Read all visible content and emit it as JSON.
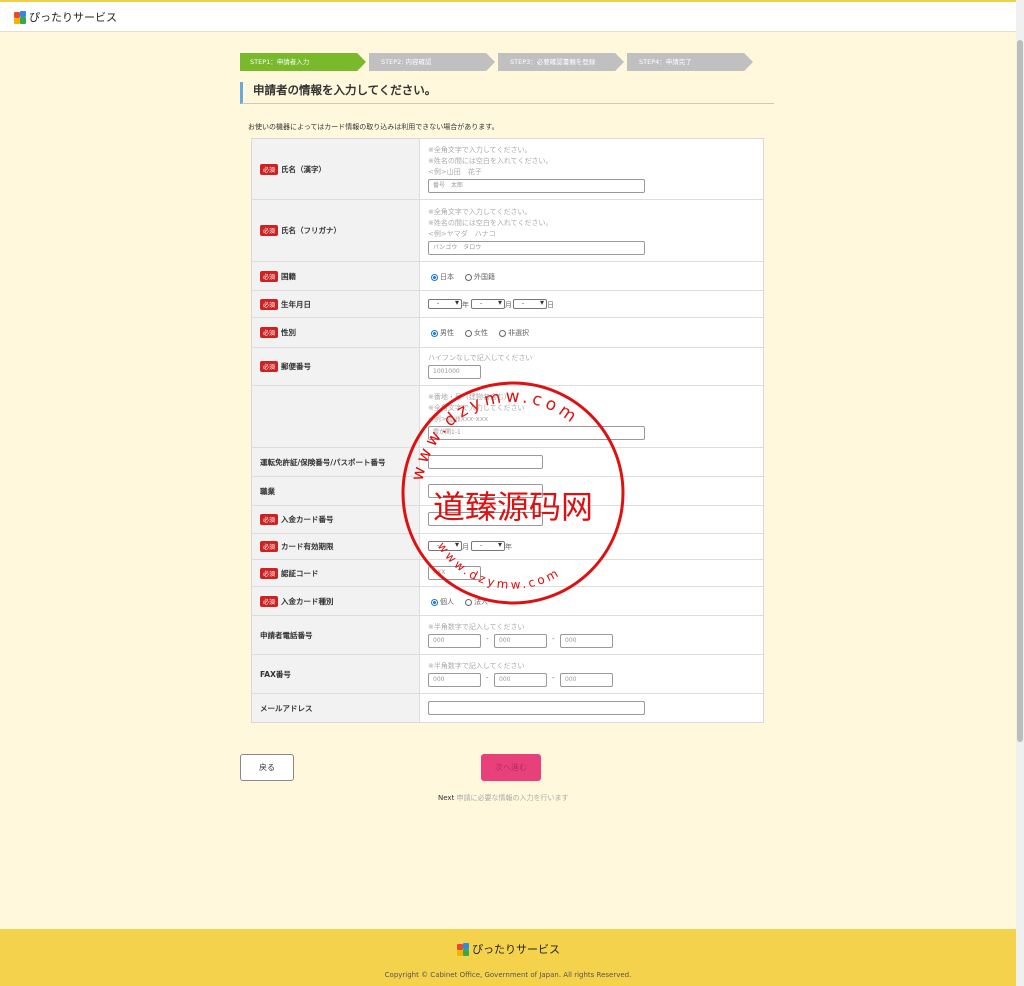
{
  "header": {
    "app_name": "ぴったりサービス"
  },
  "steps": [
    {
      "label": "STEP1：申請者入力",
      "active": true
    },
    {
      "label": "STEP2: 内容確認",
      "active": false
    },
    {
      "label": "STEP3：必要確認書類を登録",
      "active": false
    },
    {
      "label": "STEP4：申請完了",
      "active": false
    }
  ],
  "page_title": "申請者の情報を入力してください。",
  "notice": "お使いの機器によってはカード情報の取り込みは利用できない場合があります。",
  "required_badge": "必須",
  "form": {
    "name_kanji": {
      "label": "氏名（漢字）",
      "hints": [
        "※全角文字で入力してください。",
        "※姓名の間には空白を入れてください。",
        "<例>山田　花子"
      ],
      "placeholder": "番号　太郎"
    },
    "name_kana": {
      "label": "氏名（フリガナ）",
      "hints": [
        "※全角文字で入力してください。",
        "※姓名の間には空白を入れてください。",
        "<例>ヤマダ　ハナコ"
      ],
      "placeholder": "バンゴウ　タロウ"
    },
    "nationality": {
      "label": "国籍",
      "options": [
        "日本",
        "外国籍"
      ],
      "selected": "日本"
    },
    "birthdate": {
      "label": "生年月日",
      "year_value": "-",
      "month_value": "-",
      "day_value": "-",
      "year_unit": "年",
      "month_unit": "月",
      "day_unit": "日"
    },
    "gender": {
      "label": "性別",
      "options": [
        "男性",
        "女性",
        "非選択"
      ],
      "selected": "男性"
    },
    "postal_code": {
      "label": "郵便番号",
      "hint": "ハイフンなしで記入してください",
      "placeholder": "1001000"
    },
    "address": {
      "hints": [
        "※番地・号（建物名含む）",
        "※全角文字で入力してください",
        "<例>豊洲xxx-xxx"
      ],
      "placeholder": "霞が関1-1"
    },
    "license": {
      "label": "運転免許証/保険番号/パスポート番号"
    },
    "occupation": {
      "label": "職業"
    },
    "card_number": {
      "label": "入金カード番号"
    },
    "card_expiry": {
      "label": "カード有効期限",
      "month_value": "-",
      "year_value": "-",
      "month_unit": "月",
      "year_unit": "年"
    },
    "security_code": {
      "label": "認証コード",
      "placeholder": "XXX"
    },
    "card_type": {
      "label": "入金カード種別",
      "options": [
        "個人",
        "法人"
      ],
      "selected": "個人"
    },
    "phone": {
      "label": "申請者電話番号",
      "hint": "※半角数字で記入してください",
      "placeholders": [
        "000",
        "000",
        "000"
      ],
      "separator": "-"
    },
    "fax": {
      "label": "FAX番号",
      "hint": "※半角数字で記入してください",
      "placeholders": [
        "000",
        "000",
        "000"
      ],
      "separator": "-"
    },
    "email": {
      "label": "メールアドレス"
    }
  },
  "buttons": {
    "back": "戻る",
    "next": "次へ進む"
  },
  "next_note": {
    "lead": "Next",
    "text": "申請に必要な情報の入力を行います"
  },
  "footer": {
    "app_name": "ぴったりサービス",
    "copyright": "Copyright © Cabinet Office, Government of Japan. All rights Reserved."
  },
  "watermark": {
    "center_text": "道臻源码网",
    "ring_text": "www.dzymw.com",
    "color": "#dd1111"
  },
  "colors": {
    "accent_green": "#7ab82c",
    "step_grey": "#c0c0c0",
    "required_red": "#cc2222",
    "next_pink": "#e8417a",
    "footer_yellow": "#f5d24c",
    "page_bg": "#fff8dc"
  }
}
